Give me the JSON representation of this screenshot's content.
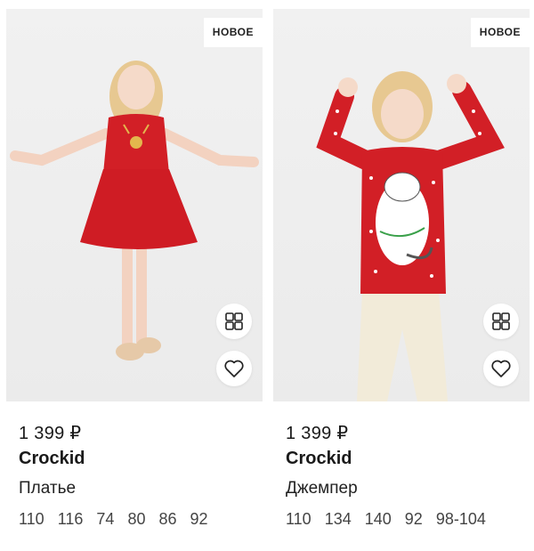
{
  "products": [
    {
      "badge": "НОВОЕ",
      "price": "1 399 ₽",
      "brand": "Crockid",
      "name": "Платье",
      "sizes": [
        "110",
        "116",
        "74",
        "80",
        "86",
        "92"
      ]
    },
    {
      "badge": "НОВОЕ",
      "price": "1 399 ₽",
      "brand": "Crockid",
      "name": "Джемпер",
      "sizes": [
        "110",
        "134",
        "140",
        "92",
        "98-104"
      ]
    }
  ],
  "icons": {
    "compare": "compare-icon",
    "favorite": "heart-icon"
  },
  "colors": {
    "garment_red": "#d21f26",
    "badge_bg": "#ffffff",
    "photo_bg": "#eeeeee"
  }
}
